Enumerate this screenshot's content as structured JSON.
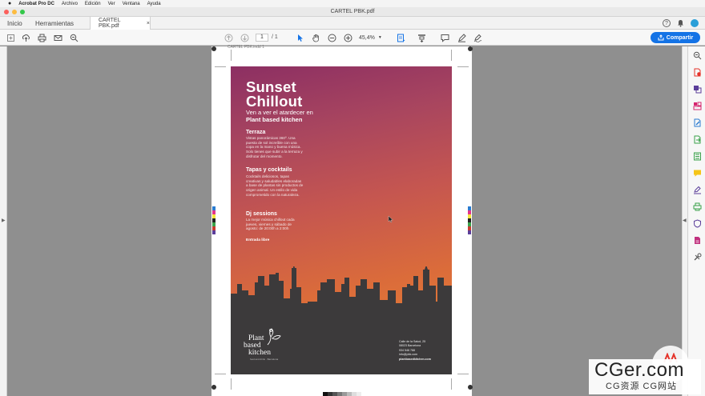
{
  "menubar": {
    "app": "Acrobat Pro DC",
    "items": [
      "Archivo",
      "Edición",
      "Ver",
      "Ventana",
      "Ayuda"
    ]
  },
  "window": {
    "title": "CARTEL PBK.pdf"
  },
  "tabs": {
    "home": "Inicio",
    "tools": "Herramientas",
    "document": "CARTEL PBK.pdf",
    "close": "×"
  },
  "toolbar": {
    "help": "?",
    "current_page": "1",
    "total_pages": "/ 1",
    "zoom": "45,4%",
    "share": "Compartir"
  },
  "document": {
    "page_label": "CARTEL PBK.indd 1"
  },
  "poster": {
    "title_line1": "Sunset",
    "title_line2": "Chillout",
    "subtitle": "Ven a ver el atardecer en",
    "subtitle_strong": "Plant based kitchen",
    "sections": [
      {
        "heading": "Terraza",
        "text": "Vistas panorámicas 360º. Una puesta de sol increíble con una copa en la mano y buena música. Solo tienes que subir a la terraza y disfrutar del momento."
      },
      {
        "heading": "Tapas y cocktails",
        "text": "Cocktails deliciosos, tapas creativas y saludables elaboradas a base de plantas sin productos de origen animal. Un estilo de vida comprometido con la naturaleza."
      },
      {
        "heading": "Dj sessions",
        "text": "La mejor música chillout cada jueves, viernes y sábado de agosto: de 20:00h a 2:00h"
      }
    ],
    "entrance": "Entrada libre",
    "logo_line1": "Plant",
    "logo_line2": "based",
    "logo_line3": "kitchen",
    "logo_tagline": "food and drink · Barcelona",
    "address_lines": [
      "Calle de la Salud, 25",
      "08023 Barcelona",
      "934 546 788",
      "info@pbk.com"
    ],
    "website": "plantbasedkitchen.com"
  },
  "watermark": {
    "big": "CGer.com",
    "small": "CG资源 CG网站"
  },
  "colors": {
    "accent": "#1473e6",
    "poster_top": "#8c2f63",
    "poster_bottom": "#e88833",
    "skyline": "#3c3a3b"
  }
}
